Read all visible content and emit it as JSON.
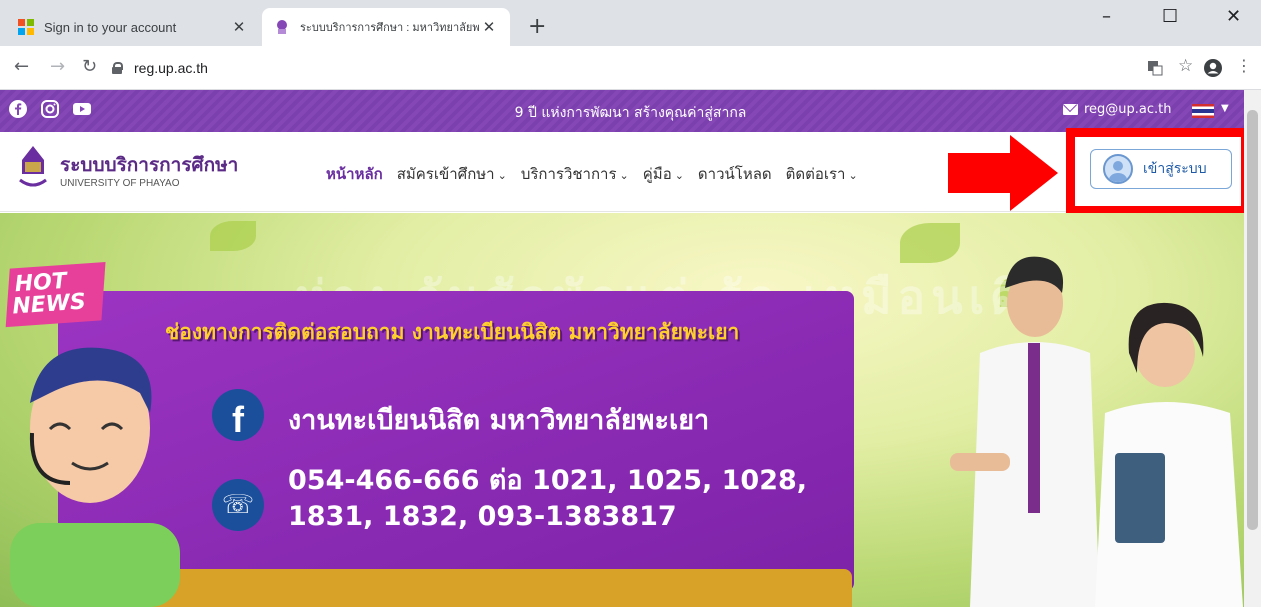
{
  "browser": {
    "tabs": [
      {
        "title": "Sign in to your account",
        "active": false
      },
      {
        "title": "ระบบบริการการศึกษา : มหาวิทยาลัยพะ",
        "active": true
      }
    ],
    "new_tab": "+",
    "url": "reg.up.ac.th",
    "window_controls": {
      "minimize": "–",
      "maximize": "☐",
      "close": "✕"
    }
  },
  "topbar": {
    "slogan": "9 ปี แห่งการพัฒนา สร้างคุณค่าสู่สากล",
    "email": "reg@up.ac.th",
    "social_icons": [
      "facebook-icon",
      "instagram-icon",
      "youtube-icon"
    ]
  },
  "header": {
    "brand_title": "ระบบบริการการศึกษา",
    "brand_subtitle": "UNIVERSITY OF PHAYAO",
    "nav": [
      {
        "label": "หน้าหลัก",
        "dropdown": false
      },
      {
        "label": "สมัครเข้าศึกษา",
        "dropdown": true
      },
      {
        "label": "บริการวิชาการ",
        "dropdown": true
      },
      {
        "label": "คู่มือ",
        "dropdown": true
      },
      {
        "label": "ดาวน์โหลด",
        "dropdown": false
      },
      {
        "label": "ติดต่อเรา",
        "dropdown": true
      }
    ],
    "login_label": "เข้าสู่ระบบ"
  },
  "banner": {
    "badge_line1": "HOT",
    "badge_line2": "NEWS",
    "heading": "ช่องทางการติดต่อสอบถาม งานทะเบียนนิสิต มหาวิทยาลัยพะเยา",
    "facebook_text": "งานทะเบียนนิสิต มหาวิทยาลัยพะเยา",
    "phone_text": "054-466-666 ต่อ 1021, 1025, 1028, 1831, 1832, 093-1383817"
  },
  "colors": {
    "brand_purple": "#8547b6",
    "annotation_red": "#ff0000",
    "login_blue": "#1e5aa8"
  }
}
